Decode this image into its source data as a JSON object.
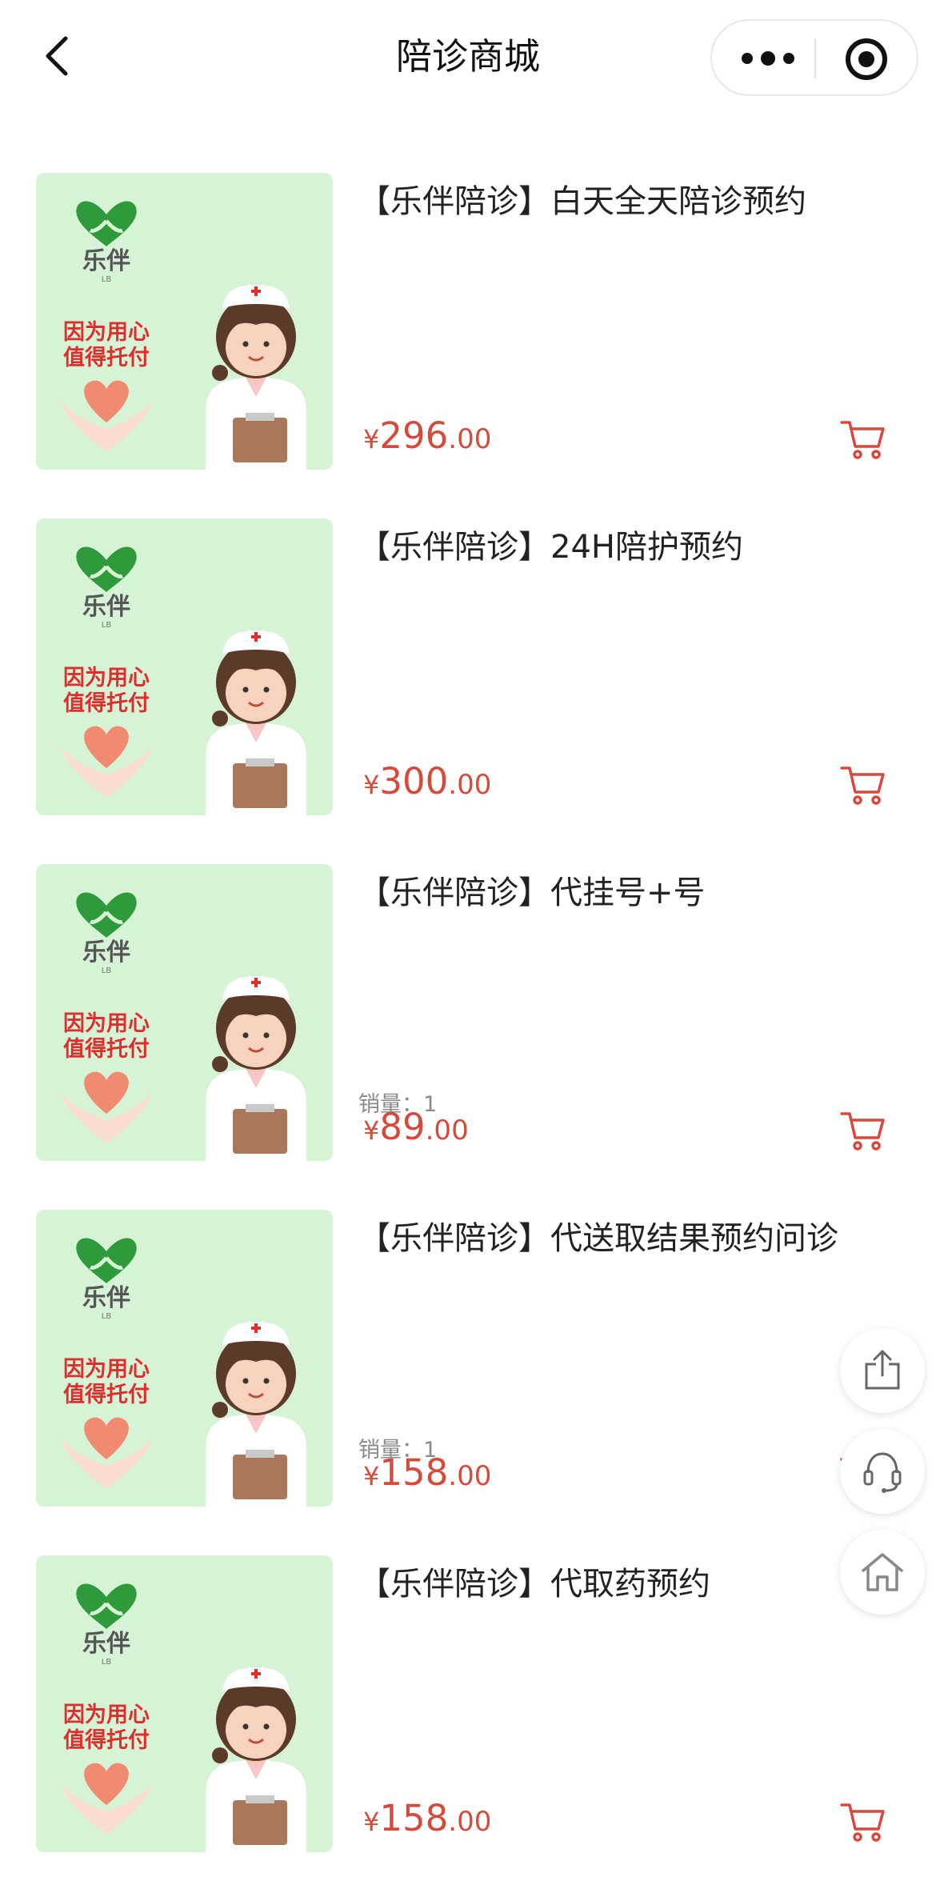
{
  "header": {
    "title": "陪诊商城",
    "back_icon": "chevron-left-icon",
    "more_icon": "more-dots-icon",
    "close_icon": "target-icon"
  },
  "thumbnail": {
    "brand_text": "乐伴",
    "brand_sub": "LB",
    "slogan_line1": "因为用心",
    "slogan_line2": "值得托付"
  },
  "colors": {
    "price": "#d64a3b",
    "thumb_bg": "#d7f3d6",
    "leaf": "#2e9a3c",
    "slogan": "#e02d2d",
    "heart": "#f08a70"
  },
  "products": [
    {
      "name": "【乐伴陪诊】白天全天陪诊预约",
      "sales": "",
      "currency": "¥",
      "price_int": "296",
      "price_dec": ".00"
    },
    {
      "name": "【乐伴陪诊】24H陪护预约",
      "sales": "",
      "currency": "¥",
      "price_int": "300",
      "price_dec": ".00"
    },
    {
      "name": "【乐伴陪诊】代挂号+号",
      "sales": "销量：1",
      "currency": "¥",
      "price_int": "89",
      "price_dec": ".00"
    },
    {
      "name": "【乐伴陪诊】代送取结果预约问诊",
      "sales": "销量：1",
      "currency": "¥",
      "price_int": "158",
      "price_dec": ".00"
    },
    {
      "name": "【乐伴陪诊】代取药预约",
      "sales": "",
      "currency": "¥",
      "price_int": "158",
      "price_dec": ".00"
    }
  ],
  "floating": [
    "share-icon",
    "customer-service-icon",
    "home-icon"
  ]
}
